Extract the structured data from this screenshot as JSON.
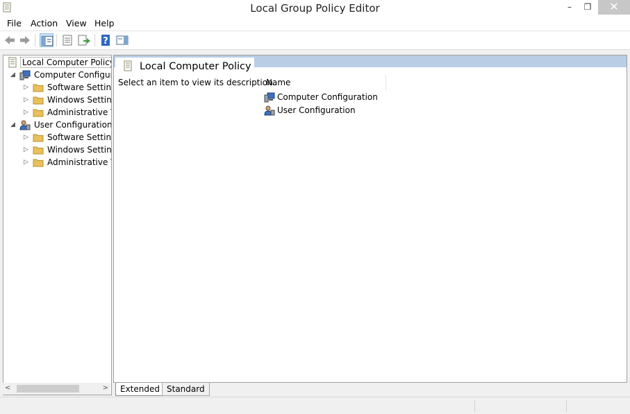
{
  "window": {
    "title": "Local Group Policy Editor",
    "minimize": "–",
    "maximize": "❐",
    "close": "✕"
  },
  "menu": [
    "File",
    "Action",
    "View",
    "Help"
  ],
  "toolbar": {
    "icons": [
      "back-arrow-icon",
      "forward-arrow-icon",
      "show-hide-tree-icon",
      "properties-icon",
      "export-list-icon",
      "help-icon",
      "show-hide-action-pane-icon"
    ]
  },
  "tree": {
    "root": "Local Computer Policy",
    "items": [
      {
        "label": "Computer Configura",
        "expander": "◢"
      },
      {
        "label": "Software Settings",
        "expander": "▷"
      },
      {
        "label": "Windows Setting",
        "expander": "▷"
      },
      {
        "label": "Administrative Te",
        "expander": "▷"
      },
      {
        "label": "User Configuration",
        "expander": "◢"
      },
      {
        "label": "Software Settings",
        "expander": "▷"
      },
      {
        "label": "Windows Setting",
        "expander": "▷"
      },
      {
        "label": "Administrative Te",
        "expander": "▷"
      }
    ]
  },
  "scroll": {
    "left": "<",
    "right": ">"
  },
  "content": {
    "title": "Local Computer Policy",
    "description": "Select an item to view its description.",
    "column": "Name",
    "items": [
      {
        "label": "Computer Configuration"
      },
      {
        "label": "User Configuration"
      }
    ]
  },
  "tabs": {
    "extended": "Extended",
    "standard": "Standard"
  },
  "colors": {
    "header_band": "#b9cde5",
    "folder": "#e8c15a",
    "selection_accent": "#cce4f7"
  }
}
